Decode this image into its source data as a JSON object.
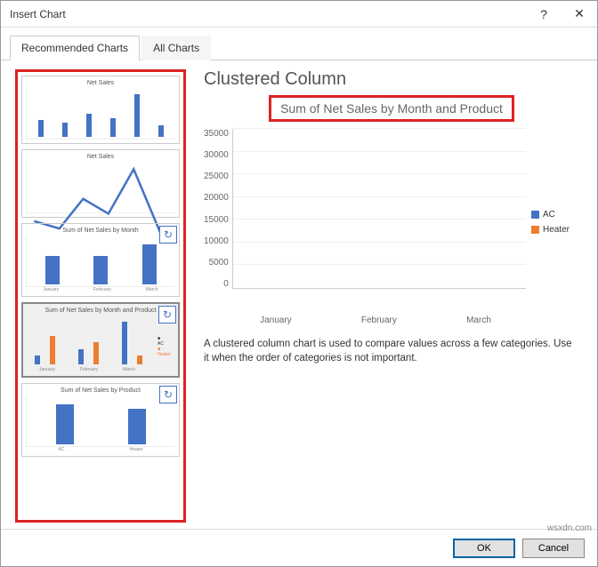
{
  "dialog": {
    "title": "Insert Chart"
  },
  "tabs": {
    "recommended": "Recommended Charts",
    "all": "All Charts"
  },
  "thumbnails": {
    "t1": {
      "title": "Net Sales"
    },
    "t2": {
      "title": "Net Sales"
    },
    "t3": {
      "title": "Sum of Net Sales by Month"
    },
    "t4": {
      "title": "Sum of Net Sales by Month and Product",
      "legend_ac": "AC",
      "legend_ht": "Heater"
    },
    "t5": {
      "title": "Sum of Net Sales by Product"
    },
    "xlabels_months": [
      "January",
      "February",
      "March"
    ],
    "xlabels_products": [
      "AC",
      "Heater"
    ]
  },
  "preview": {
    "chart_type": "Clustered Column",
    "chart_title": "Sum of Net Sales by Month and Product",
    "legend": {
      "ac": "AC",
      "heater": "Heater"
    },
    "description": "A clustered column chart is used to compare values across a few categories. Use it when the order of categories is not important."
  },
  "buttons": {
    "ok": "OK",
    "cancel": "Cancel"
  },
  "watermark": "wsxdn.com",
  "chart_data": {
    "type": "bar",
    "title": "Sum of Net Sales by Month and Product",
    "categories": [
      "January",
      "February",
      "March"
    ],
    "series": [
      {
        "name": "AC",
        "values": [
          5000,
          10000,
          30000
        ]
      },
      {
        "name": "Heater",
        "values": [
          20000,
          15000,
          5000
        ]
      }
    ],
    "ylabel": "",
    "xlabel": "",
    "ylim": [
      0,
      35000
    ],
    "yticks": [
      0,
      5000,
      10000,
      15000,
      20000,
      25000,
      30000,
      35000
    ]
  }
}
